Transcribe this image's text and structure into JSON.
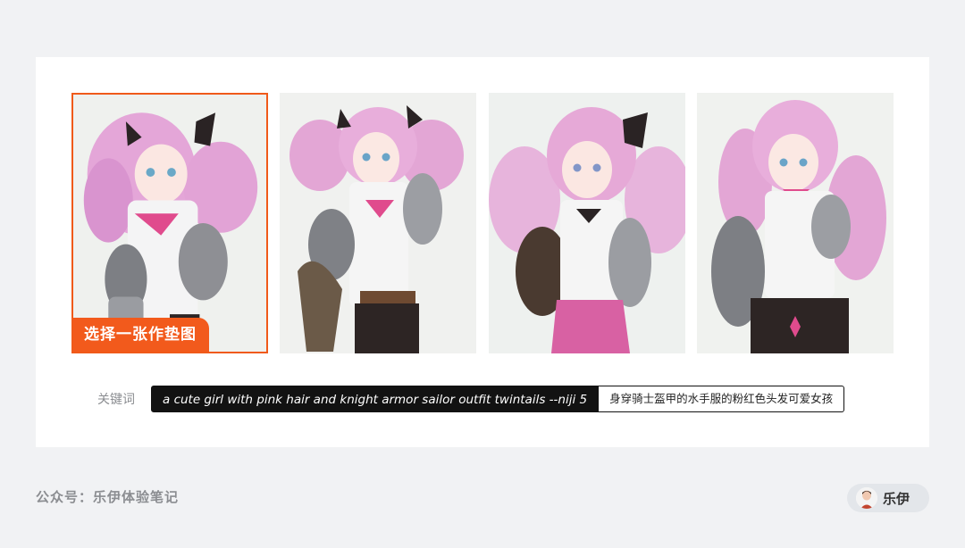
{
  "gallery": {
    "badge_label": "选择一张作垫图",
    "selected_index": 0,
    "images": [
      {
        "name": "anime-knight-girl-image-1"
      },
      {
        "name": "anime-knight-girl-image-2"
      },
      {
        "name": "anime-knight-girl-image-3"
      },
      {
        "name": "anime-knight-girl-image-4"
      }
    ]
  },
  "keywords": {
    "label": "关键词",
    "prompt_en": "a cute girl with pink hair and knight armor sailor outfit twintails --niji 5",
    "prompt_zh": "身穿骑士盔甲的水手服的粉红色头发可爱女孩"
  },
  "footer": {
    "source": "公众号：乐伊体验笔记",
    "author_name": "乐伊"
  },
  "colors": {
    "accent": "#f25a1c",
    "page_bg": "#f1f2f4",
    "card_bg": "#ffffff",
    "prompt_bg": "#121212"
  }
}
